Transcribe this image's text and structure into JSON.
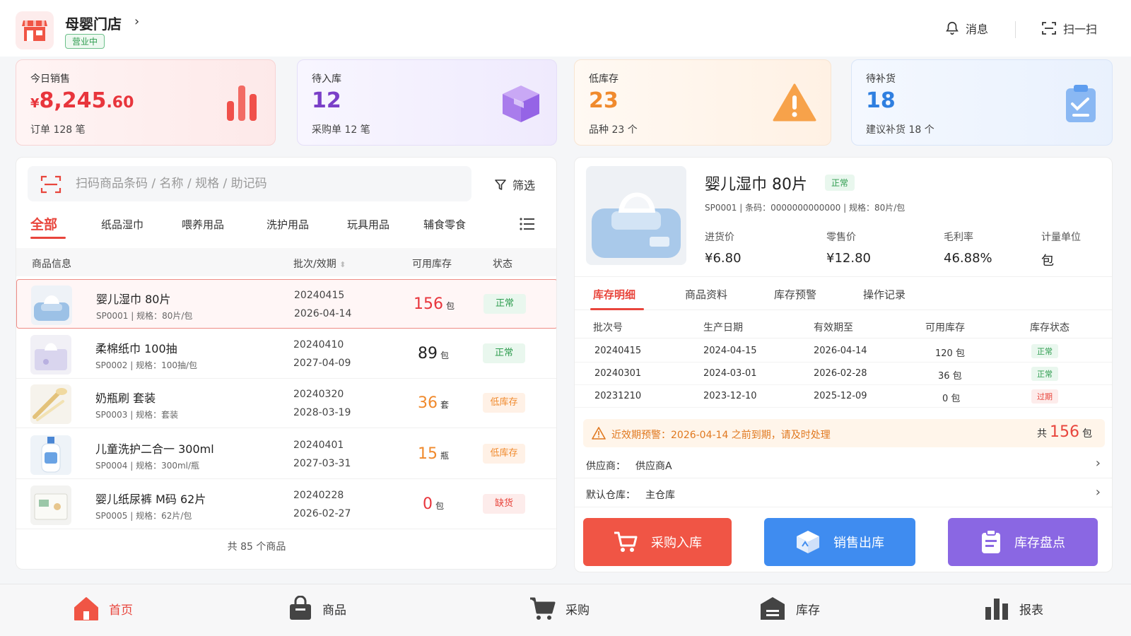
{
  "store": {
    "name": "母婴门店",
    "status": "营业中"
  },
  "header": {
    "messages": "消息",
    "scan": "扫一扫"
  },
  "stats": [
    {
      "label": "今日销售",
      "currency": "¥",
      "value_int": "8,245",
      "value_dec": ".60",
      "sub": "订单 128 笔",
      "color": "#e8353c"
    },
    {
      "label": "待入库",
      "value": "12",
      "sub": "采购单 12 笔",
      "color": "#7a3fc8"
    },
    {
      "label": "低库存",
      "value": "23",
      "sub": "品种 23 个",
      "color": "#f08a2d"
    },
    {
      "label": "待补货",
      "value": "18",
      "sub": "建议补货 18 个",
      "color": "#2f7fe0"
    }
  ],
  "search": {
    "placeholder": "扫码商品条码 / 名称 / 规格 / 助记码",
    "filter": "筛选"
  },
  "tabs": [
    "全部",
    "纸品湿巾",
    "喂养用品",
    "洗护用品",
    "玩具用品",
    "辅食零食"
  ],
  "table": {
    "headers": [
      "商品信息",
      "批次/效期",
      "可用库存",
      "状态"
    ],
    "rows": [
      {
        "name": "婴儿湿巾 80片",
        "meta": "SP0001 | 规格：80片/包",
        "batch": "20240415",
        "expiry": "2026-04-14",
        "qty": "156",
        "unit": "包",
        "status": "正常",
        "qty_color": "#e8353c"
      },
      {
        "name": "柔棉纸巾 100抽",
        "meta": "SP0002 | 规格：100抽/包",
        "batch": "20240410",
        "expiry": "2027-04-09",
        "qty": "89",
        "unit": "包",
        "status": "正常",
        "qty_color": "#222222"
      },
      {
        "name": "奶瓶刷 套装",
        "meta": "SP0003 | 规格：套装",
        "batch": "20240320",
        "expiry": "2028-03-19",
        "qty": "36",
        "unit": "套",
        "status": "低库存",
        "qty_color": "#f08a2d"
      },
      {
        "name": "儿童洗护二合一 300ml",
        "meta": "SP0004 | 规格：300ml/瓶",
        "batch": "20240401",
        "expiry": "2027-03-31",
        "qty": "15",
        "unit": "瓶",
        "status": "低库存",
        "qty_color": "#f08a2d"
      },
      {
        "name": "婴儿纸尿裤 M码 62片",
        "meta": "SP0005 | 规格：62片/包",
        "batch": "20240228",
        "expiry": "2026-02-27",
        "qty": "0",
        "unit": "包",
        "status": "缺货",
        "qty_color": "#e8353c"
      }
    ],
    "total": "共 85 个商品"
  },
  "detail": {
    "name": "婴儿湿巾 80片",
    "status": "正常",
    "meta": "SP0001 | 条码：0000000000000 | 规格：80片/包",
    "fields": [
      {
        "label": "进货价",
        "value": "¥6.80"
      },
      {
        "label": "零售价",
        "value": "¥12.80"
      },
      {
        "label": "毛利率",
        "value": "46.88%"
      },
      {
        "label": "计量单位",
        "value": "包"
      }
    ],
    "tabs": [
      "库存明细",
      "商品资料",
      "库存预警",
      "操作记录"
    ],
    "batch_headers": [
      "批次号",
      "生产日期",
      "有效期至",
      "可用库存",
      "库存状态"
    ],
    "batches": [
      {
        "batch": "20240415",
        "prod": "2024-04-15",
        "exp": "2026-04-14",
        "qty": "120 包",
        "status": "正常"
      },
      {
        "batch": "20240301",
        "prod": "2024-03-01",
        "exp": "2026-02-28",
        "qty": "36 包",
        "status": "正常"
      },
      {
        "batch": "20231210",
        "prod": "2023-12-10",
        "exp": "2025-12-09",
        "qty": "0 包",
        "status": "过期"
      }
    ],
    "warning": "近效期预警：2026-04-14 之前到期，请及时处理",
    "total_prefix": "共",
    "total_qty": "156",
    "total_unit": "包",
    "supplier_label": "供应商：",
    "supplier": "供应商A",
    "warehouse_label": "默认仓库：",
    "warehouse": "主仓库",
    "actions": [
      "采购入库",
      "销售出库",
      "库存盘点"
    ]
  },
  "nav": [
    "首页",
    "商品",
    "采购",
    "库存",
    "报表"
  ]
}
